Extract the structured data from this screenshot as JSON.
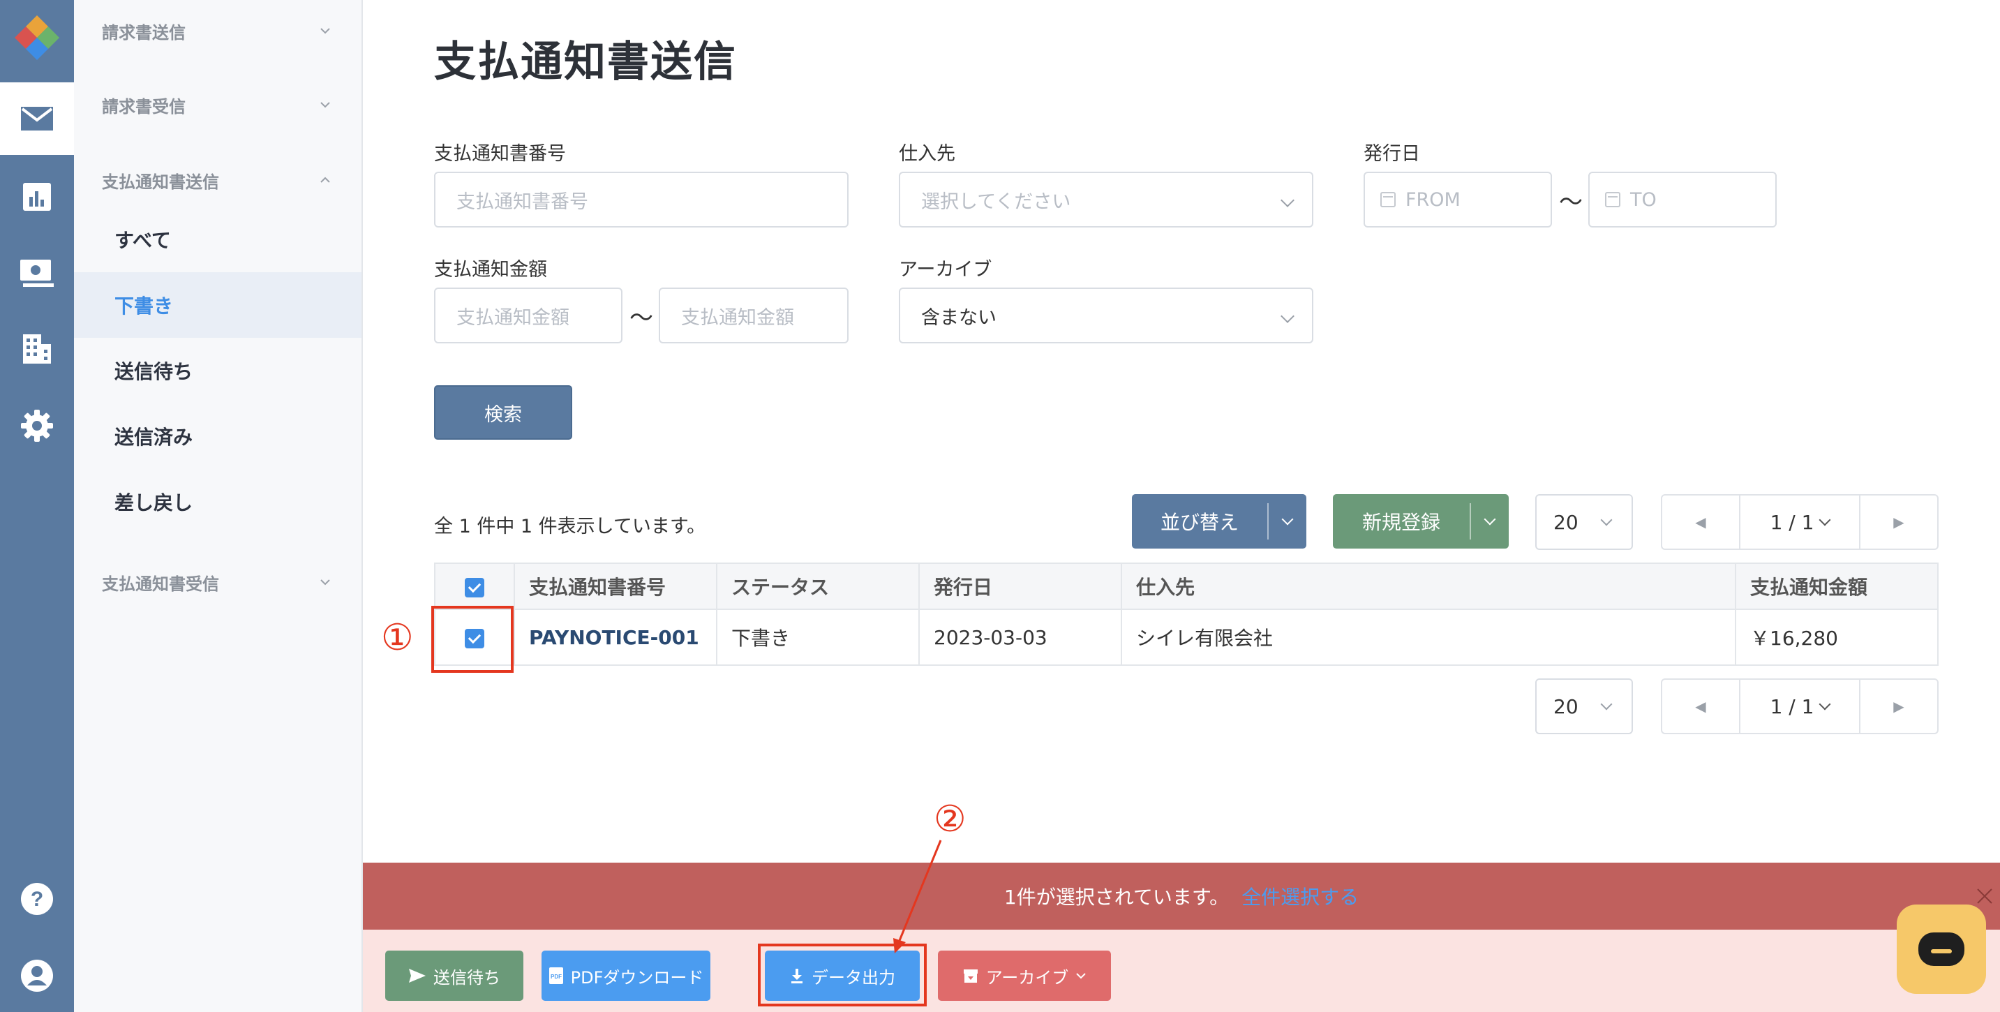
{
  "sidebar": {
    "groups": [
      {
        "label": "請求書送信"
      },
      {
        "label": "請求書受信"
      },
      {
        "label": "支払通知書送信"
      },
      {
        "label": "支払通知書受信"
      }
    ],
    "items": [
      {
        "label": "すべて"
      },
      {
        "label": "下書き"
      },
      {
        "label": "送信待ち"
      },
      {
        "label": "送信済み"
      },
      {
        "label": "差し戻し"
      }
    ],
    "active_item": "下書き"
  },
  "page": {
    "title": "支払通知書送信"
  },
  "filters": {
    "number": {
      "label": "支払通知書番号",
      "placeholder": "支払通知書番号"
    },
    "supplier": {
      "label": "仕入先",
      "placeholder": "選択してください"
    },
    "issue_date": {
      "label": "発行日",
      "from_placeholder": "FROM",
      "to_placeholder": "TO",
      "separator": "〜"
    },
    "amount": {
      "label": "支払通知金額",
      "min_placeholder": "支払通知金額",
      "max_placeholder": "支払通知金額",
      "separator": "〜"
    },
    "archive": {
      "label": "アーカイブ",
      "value": "含まない"
    },
    "search_button": "検索"
  },
  "results": {
    "count_text": "全 1 件中 1 件表示しています。",
    "sort_button": "並び替え",
    "new_button": "新規登録",
    "per_page": "20",
    "page_text": "1 / 1"
  },
  "table": {
    "headers": [
      "支払通知書番号",
      "ステータス",
      "発行日",
      "仕入先",
      "支払通知金額"
    ],
    "rows": [
      {
        "number": "PAYNOTICE-001",
        "status": "下書き",
        "date": "2023-03-03",
        "supplier": "シイレ有限会社",
        "amount": "￥16,280"
      }
    ]
  },
  "annotations": {
    "one": "①",
    "two": "②"
  },
  "selection_bar": {
    "text": "1件が選択されています。",
    "select_all": "全件選択する"
  },
  "actions": {
    "send_wait": "送信待ち",
    "pdf": "PDFダウンロード",
    "data_export": "データ出力",
    "archive": "アーカイブ"
  },
  "colors": {
    "rail": "#5a7aa0",
    "primary_blue": "#3e8de5",
    "green": "#6b9a79",
    "selection_red": "#c0605d",
    "archive_red": "#df6b6b",
    "annotation_red": "#e4371f"
  }
}
